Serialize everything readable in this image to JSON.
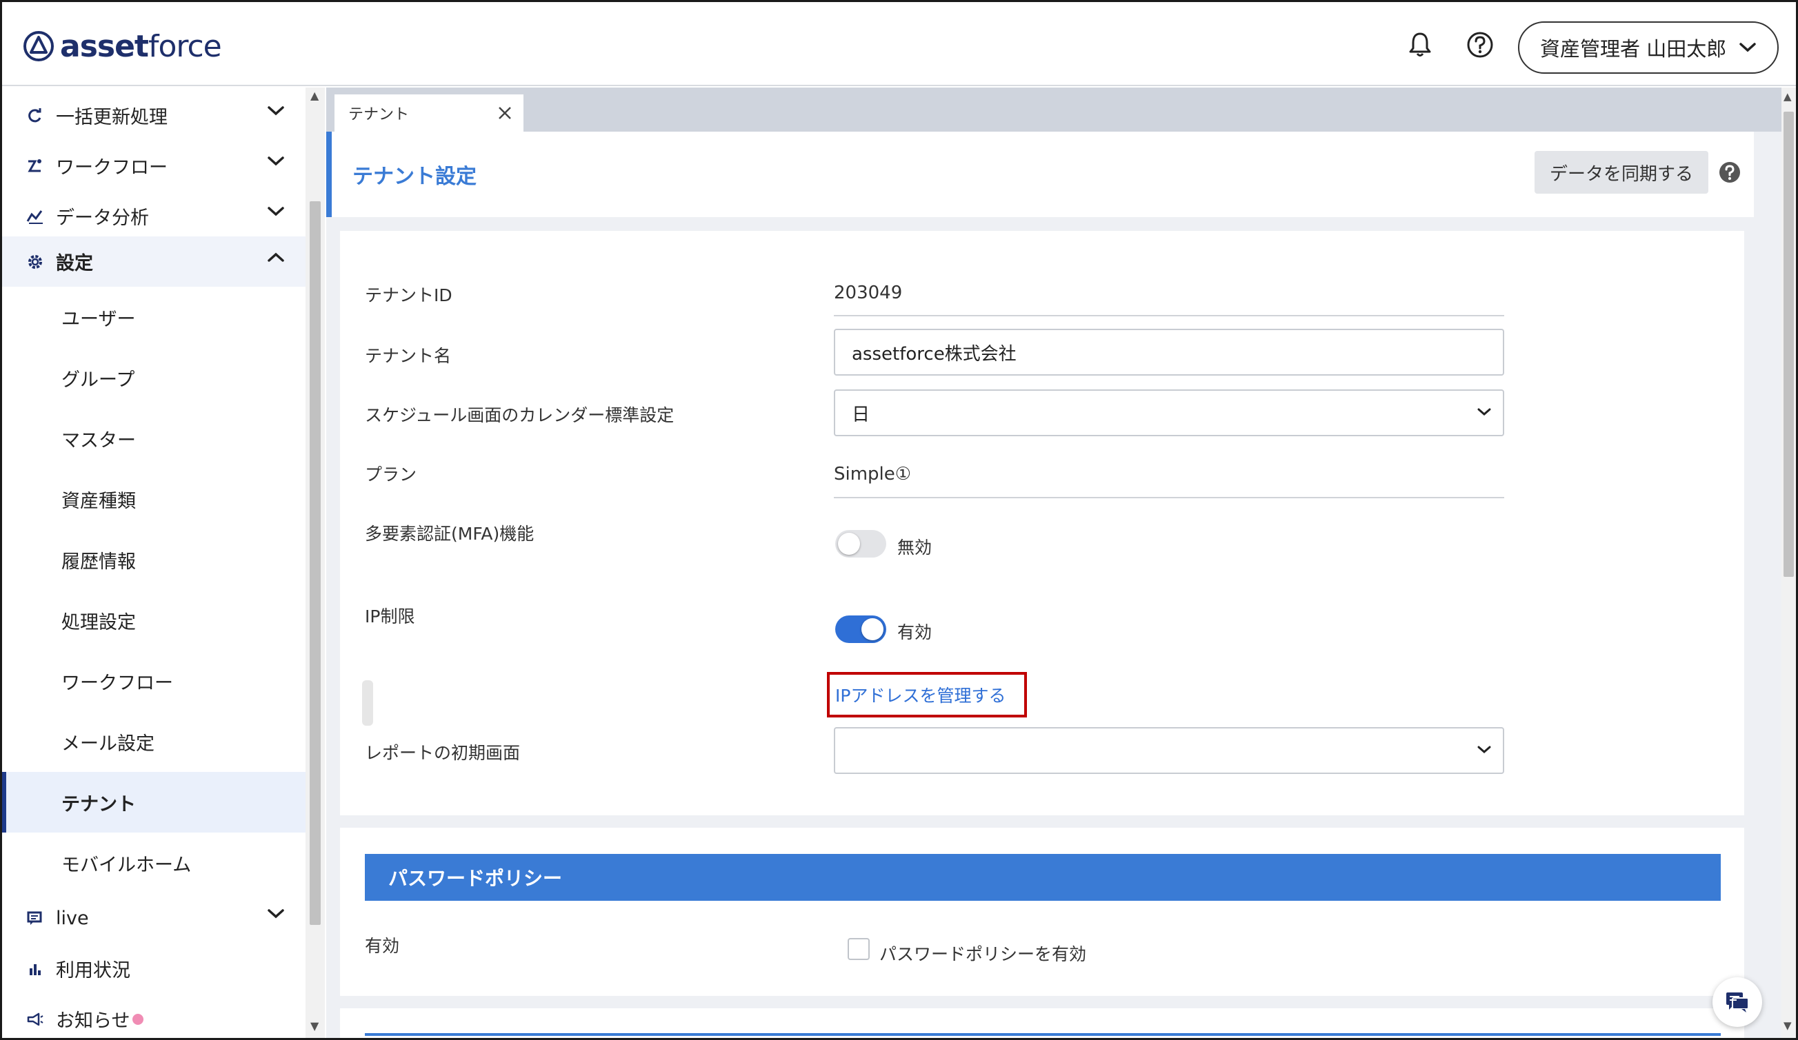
{
  "app": {
    "logo_bold": "asset",
    "logo_light": "force"
  },
  "header": {
    "user_label": "資産管理者 山田太郎"
  },
  "sidebar": {
    "top_items": [
      {
        "label": "一括更新処理",
        "icon": "refresh-icon"
      },
      {
        "label": "ワークフロー",
        "icon": "workflow-icon"
      },
      {
        "label": "データ分析",
        "icon": "analytics-icon"
      },
      {
        "label": "設定",
        "icon": "gear-icon"
      }
    ],
    "settings_items": [
      {
        "label": "ユーザー"
      },
      {
        "label": "グループ"
      },
      {
        "label": "マスター"
      },
      {
        "label": "資産種類"
      },
      {
        "label": "履歴情報"
      },
      {
        "label": "処理設定"
      },
      {
        "label": "ワークフロー"
      },
      {
        "label": "メール設定"
      },
      {
        "label": "テナント"
      },
      {
        "label": "モバイルホーム"
      }
    ],
    "bottom_items": [
      {
        "label": "live",
        "icon": "chat-icon"
      },
      {
        "label": "利用状況",
        "icon": "bar-chart-icon"
      },
      {
        "label": "お知らせ",
        "icon": "megaphone-icon"
      }
    ]
  },
  "tabs": [
    {
      "label": "テナント"
    }
  ],
  "page": {
    "title": "テナント設定",
    "sync_button": "データを同期する"
  },
  "form": {
    "tenant_id_label": "テナントID",
    "tenant_id_value": "203049",
    "tenant_name_label": "テナント名",
    "tenant_name_value": "assetforce株式会社",
    "calendar_label": "スケジュール画面のカレンダー標準設定",
    "calendar_value": "日",
    "plan_label": "プラン",
    "plan_value": "Simple①",
    "mfa_label": "多要素認証(MFA)機能",
    "mfa_state_label": "無効",
    "mfa_enabled": false,
    "ip_label": "IP制限",
    "ip_state_label": "有効",
    "ip_enabled": true,
    "ip_manage_link": "IPアドレスを管理する",
    "report_label": "レポートの初期画面",
    "report_value": ""
  },
  "password_policy": {
    "section_title": "パスワードポリシー",
    "enabled_label": "有効",
    "checkbox_label": "パスワードポリシーを有効",
    "checked": false
  },
  "colors": {
    "accent": "#3a7bd5",
    "brand_navy": "#1e2f6b",
    "highlight_red": "#c00000",
    "link": "#2f6fd6"
  }
}
